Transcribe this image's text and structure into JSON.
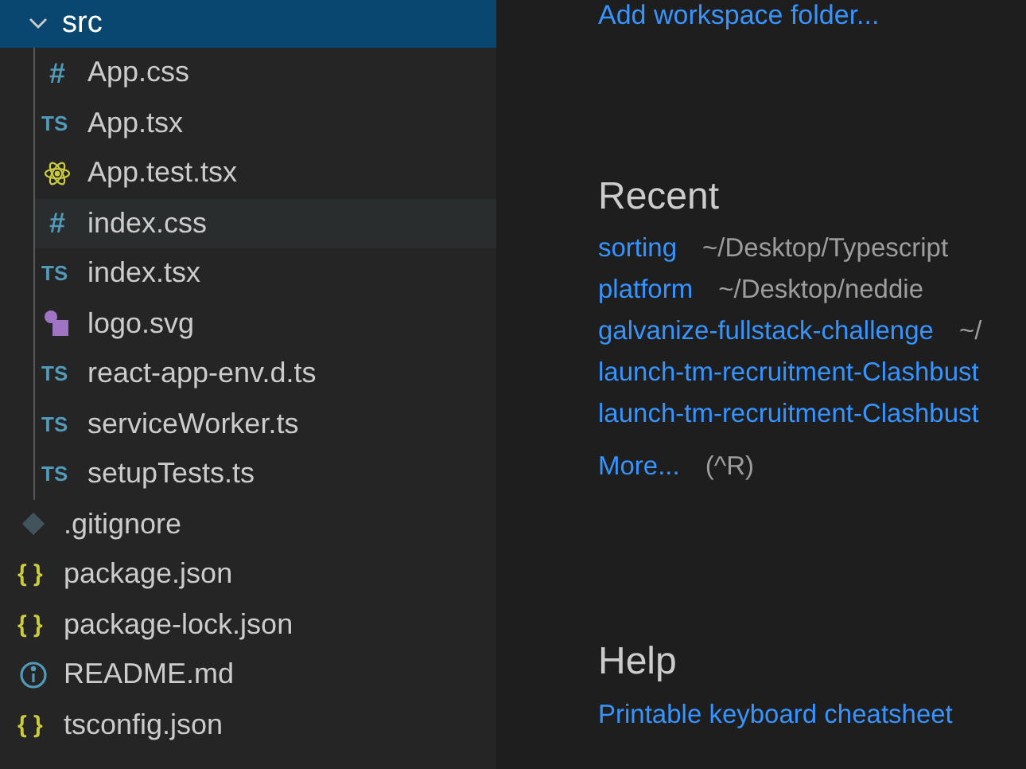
{
  "explorer": {
    "folder": {
      "name": "src",
      "expanded": true,
      "selected": true,
      "children": [
        {
          "name": "App.css",
          "kind": "css",
          "icon_text": "#",
          "hovered": false
        },
        {
          "name": "App.tsx",
          "kind": "ts",
          "icon_text": "TS",
          "hovered": false
        },
        {
          "name": "App.test.tsx",
          "kind": "react",
          "hovered": false
        },
        {
          "name": "index.css",
          "kind": "css",
          "icon_text": "#",
          "hovered": true
        },
        {
          "name": "index.tsx",
          "kind": "ts",
          "icon_text": "TS",
          "hovered": false
        },
        {
          "name": "logo.svg",
          "kind": "svg",
          "hovered": false
        },
        {
          "name": "react-app-env.d.ts",
          "kind": "ts",
          "icon_text": "TS",
          "hovered": false
        },
        {
          "name": "serviceWorker.ts",
          "kind": "ts",
          "icon_text": "TS",
          "hovered": false
        },
        {
          "name": "setupTests.ts",
          "kind": "ts",
          "icon_text": "TS",
          "hovered": false
        }
      ]
    },
    "files": [
      {
        "name": ".gitignore",
        "kind": "git",
        "hovered": false
      },
      {
        "name": "package.json",
        "kind": "json",
        "icon_text": "{ }",
        "hovered": false
      },
      {
        "name": "package-lock.json",
        "kind": "json",
        "icon_text": "{ }",
        "hovered": false
      },
      {
        "name": "README.md",
        "kind": "info",
        "hovered": false
      },
      {
        "name": "tsconfig.json",
        "kind": "json",
        "icon_text": "{ }",
        "hovered": false
      }
    ]
  },
  "welcome": {
    "add_workspace_link": "Add workspace folder...",
    "recent": {
      "title": "Recent",
      "items": [
        {
          "name": "sorting",
          "path": "~/Desktop/Typescript"
        },
        {
          "name": "platform",
          "path": "~/Desktop/neddie"
        },
        {
          "name": "galvanize-fullstack-challenge",
          "path": "~/"
        },
        {
          "name": "launch-tm-recruitment-Clashbust"
        },
        {
          "name": "launch-tm-recruitment-Clashbust"
        }
      ],
      "more": "More...",
      "shortcut": "(^R)"
    },
    "help": {
      "title": "Help",
      "links": [
        "Printable keyboard cheatsheet"
      ]
    }
  }
}
